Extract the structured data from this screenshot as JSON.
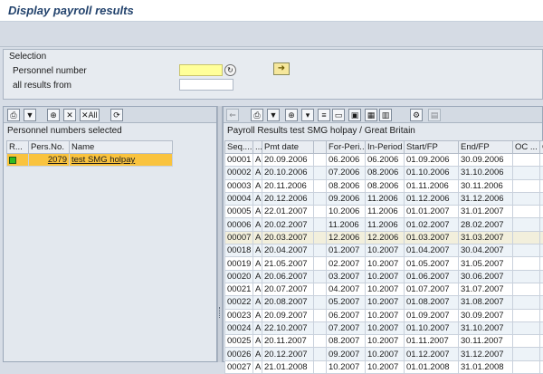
{
  "window": {
    "title": "Display payroll results"
  },
  "selection": {
    "header": "Selection",
    "personnel_label": "Personnel number",
    "all_results_label": "all results from",
    "personnel_value": "",
    "all_results_value": ""
  },
  "left_pane": {
    "title": "Personnel numbers selected",
    "all_button_label": "All",
    "columns": [
      "R...",
      "Pers.No.",
      "Name"
    ],
    "rows": [
      {
        "status": "green",
        "pers_no": "2079",
        "name": "test SMG holpay"
      }
    ]
  },
  "right_pane": {
    "title": "Payroll Results test SMG holpay / Great Britain",
    "columns": [
      "Seq....",
      "...",
      "Pmt date",
      "",
      "For-Peri...",
      "In-Period",
      "Start/FP",
      "End/FP",
      "OC ...",
      "C"
    ],
    "rows": [
      [
        "00001",
        "A",
        "20.09.2006",
        "",
        "06.2006",
        "06.2006",
        "01.09.2006",
        "30.09.2006",
        "",
        ""
      ],
      [
        "00002",
        "A",
        "20.10.2006",
        "",
        "07.2006",
        "08.2006",
        "01.10.2006",
        "31.10.2006",
        "",
        ""
      ],
      [
        "00003",
        "A",
        "20.11.2006",
        "",
        "08.2006",
        "08.2006",
        "01.11.2006",
        "30.11.2006",
        "",
        ""
      ],
      [
        "00004",
        "A",
        "20.12.2006",
        "",
        "09.2006",
        "11.2006",
        "01.12.2006",
        "31.12.2006",
        "",
        ""
      ],
      [
        "00005",
        "A",
        "22.01.2007",
        "",
        "10.2006",
        "11.2006",
        "01.01.2007",
        "31.01.2007",
        "",
        ""
      ],
      [
        "00006",
        "A",
        "20.02.2007",
        "",
        "11.2006",
        "11.2006",
        "01.02.2007",
        "28.02.2007",
        "",
        ""
      ],
      [
        "00007",
        "A",
        "20.03.2007",
        "",
        "12.2006",
        "12.2006",
        "01.03.2007",
        "31.03.2007",
        "",
        ""
      ],
      [
        "00018",
        "A",
        "20.04.2007",
        "",
        "01.2007",
        "10.2007",
        "01.04.2007",
        "30.04.2007",
        "",
        ""
      ],
      [
        "00019",
        "A",
        "21.05.2007",
        "",
        "02.2007",
        "10.2007",
        "01.05.2007",
        "31.05.2007",
        "",
        ""
      ],
      [
        "00020",
        "A",
        "20.06.2007",
        "",
        "03.2007",
        "10.2007",
        "01.06.2007",
        "30.06.2007",
        "",
        ""
      ],
      [
        "00021",
        "A",
        "20.07.2007",
        "",
        "04.2007",
        "10.2007",
        "01.07.2007",
        "31.07.2007",
        "",
        ""
      ],
      [
        "00022",
        "A",
        "20.08.2007",
        "",
        "05.2007",
        "10.2007",
        "01.08.2007",
        "31.08.2007",
        "",
        ""
      ],
      [
        "00023",
        "A",
        "20.09.2007",
        "",
        "06.2007",
        "10.2007",
        "01.09.2007",
        "30.09.2007",
        "",
        ""
      ],
      [
        "00024",
        "A",
        "22.10.2007",
        "",
        "07.2007",
        "10.2007",
        "01.10.2007",
        "31.10.2007",
        "",
        ""
      ],
      [
        "00025",
        "A",
        "20.11.2007",
        "",
        "08.2007",
        "10.2007",
        "01.11.2007",
        "30.11.2007",
        "",
        ""
      ],
      [
        "00026",
        "A",
        "20.12.2007",
        "",
        "09.2007",
        "10.2007",
        "01.12.2007",
        "31.12.2007",
        "",
        ""
      ],
      [
        "00027",
        "A",
        "21.01.2008",
        "",
        "10.2007",
        "10.2007",
        "01.01.2008",
        "31.01.2008",
        "",
        ""
      ]
    ]
  },
  "colors": {
    "title": "#23436d",
    "selected_row": "#f9c33e",
    "status_ok": "#2fbb20",
    "required_field": "#ffff99"
  }
}
